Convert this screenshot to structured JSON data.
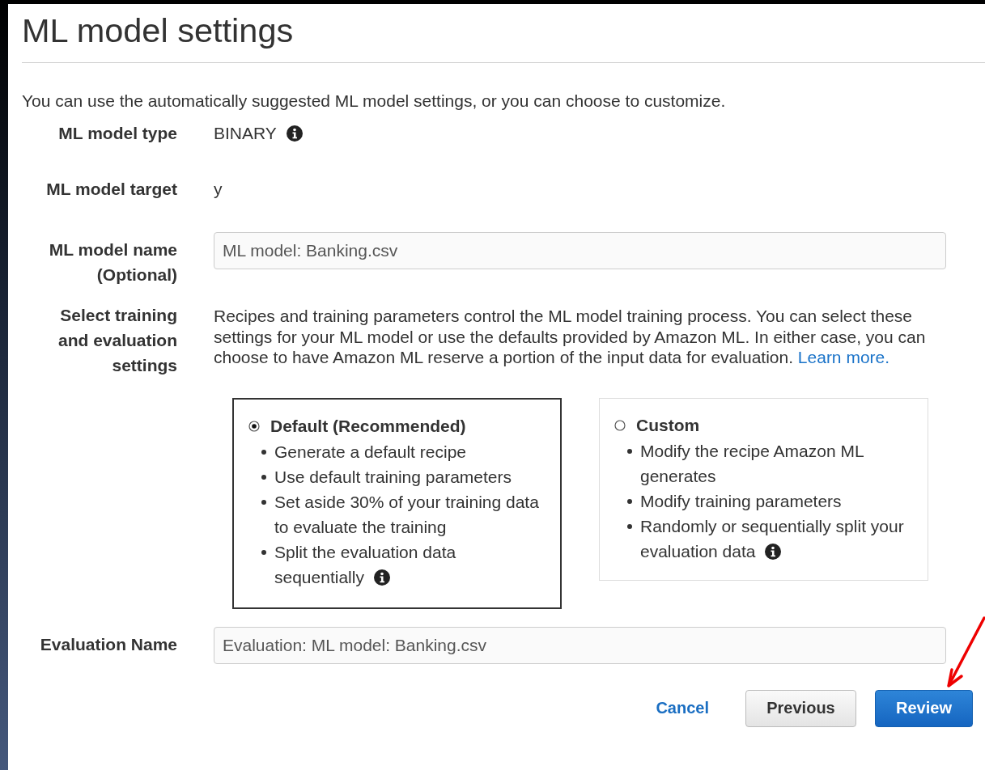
{
  "title": "ML model settings",
  "intro": "You can use the automatically suggested ML model settings, or you can choose to customize.",
  "fields": [
    {
      "kind": "text",
      "label": "ML model type",
      "value": "BINARY",
      "info": true
    },
    {
      "kind": "text",
      "label": "ML model target",
      "value": "y",
      "info": false
    },
    {
      "kind": "input",
      "label": "ML model name (Optional)",
      "value": "ML model: Banking.csv"
    },
    {
      "kind": "options",
      "label": "Select training and evaluation settings",
      "description": "Recipes and training parameters control the ML model training process. You can select these settings for your ML model or use the defaults provided by Amazon ML. In either case, you can choose to have Amazon ML reserve a portion of the input data for evaluation.",
      "link": "Learn more.",
      "options": [
        {
          "title": "Default (Recommended)",
          "selected": true,
          "bullets": [
            {
              "text": "Generate a default recipe",
              "info": false
            },
            {
              "text": "Use default training parameters",
              "info": false
            },
            {
              "text": "Set aside 30% of your training data to evaluate the training",
              "info": false
            },
            {
              "text": "Split the evaluation data sequentially",
              "info": true
            }
          ]
        },
        {
          "title": "Custom",
          "selected": false,
          "bullets": [
            {
              "text": "Modify the recipe Amazon ML generates",
              "info": false
            },
            {
              "text": "Modify training parameters",
              "info": false
            },
            {
              "text": "Randomly or sequentially split your evaluation data",
              "info": true
            }
          ]
        }
      ]
    },
    {
      "kind": "input",
      "label": "Evaluation Name",
      "value": "Evaluation: ML model: Banking.csv"
    }
  ],
  "buttons": [
    {
      "kind": "link",
      "label": "Cancel"
    },
    {
      "kind": "secondary",
      "label": "Previous"
    },
    {
      "kind": "primary",
      "label": "Review"
    }
  ]
}
